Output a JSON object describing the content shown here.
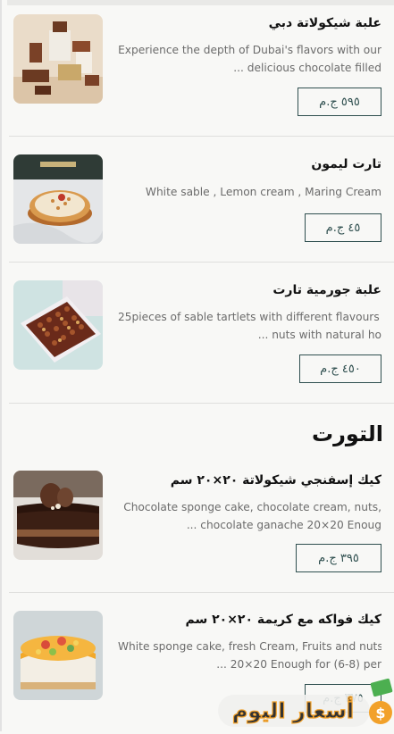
{
  "items_top": [
    {
      "title": "علبة شيكولاتة دبي",
      "desc_line1": "Experience the depth of Dubai's flavors with our",
      "desc_line2": "... delicious chocolate filled",
      "price": "٥٩٥ ج.م"
    },
    {
      "title": "تارت ليمون",
      "desc_line1": "White sable , Lemon cream , Maring Cream",
      "desc_line2": "",
      "price": "٤٥ ج.م"
    },
    {
      "title": "علبة جورمية تارت",
      "desc_line1": "25pieces of sable tartlets with different flavours -",
      "desc_line2": "... nuts with natural ho",
      "price": "٤٥٠ ج.م"
    }
  ],
  "section": {
    "title": "التورت"
  },
  "items_bottom": [
    {
      "title": "كيك إسفنجي شيكولاتة ٢٠×٢٠ سم",
      "desc_line1": "Chocolate sponge cake, chocolate cream, nuts,",
      "desc_line2": "... chocolate ganache 20×20 Enoug",
      "price": "٣٩٥ ج.م"
    },
    {
      "title": "كيك فواكه مع كريمة ٢٠×٢٠ سم",
      "desc_line1": "White sponge cake, fresh Cream, Fruits and nuts",
      "desc_line2": "... 20×20 Enough for (6-8) per",
      "price": "٣٧٥ ج.م"
    }
  ],
  "watermark": {
    "text": "أسعار اليوم",
    "icon": "money-icon"
  },
  "colors": {
    "accent": "#2f4f4f",
    "background": "#f8f8f6",
    "desc": "#6b6b6b"
  }
}
